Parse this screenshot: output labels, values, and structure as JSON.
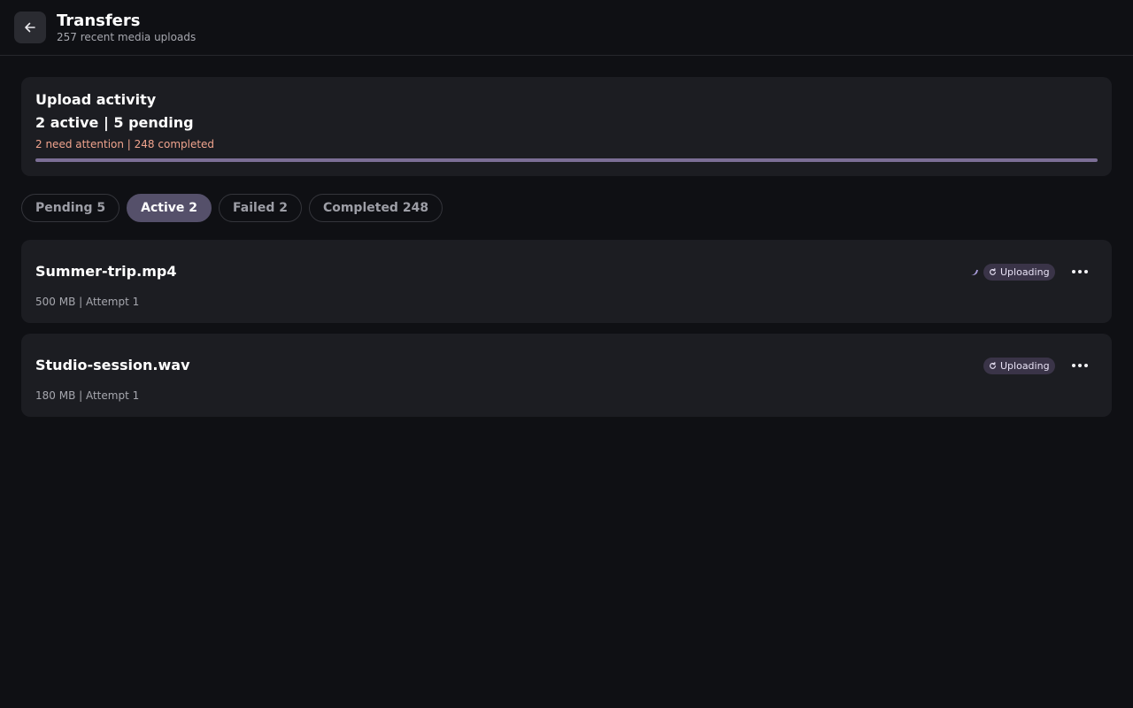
{
  "header": {
    "back_icon": "arrow-left-icon",
    "title": "Transfers",
    "subtitle": "257 recent media uploads"
  },
  "summary": {
    "title": "Upload activity",
    "main": "2 active | 5 pending",
    "attention": "2 need attention | 248 completed",
    "attention_color": "#f1a48e",
    "progress_fraction": 1.0
  },
  "tabs": [
    {
      "label": "Pending 5",
      "active": false
    },
    {
      "label": "Active 2",
      "active": true
    },
    {
      "label": "Failed 2",
      "active": false
    },
    {
      "label": "Completed 248",
      "active": false
    }
  ],
  "transfers": [
    {
      "name": "Summer-trip.mp4",
      "meta": "500 MB | Attempt 1",
      "status": "Uploading",
      "status_icon": "refresh-icon",
      "more_icon": "more-horizontal-icon"
    },
    {
      "name": "Studio-session.wav",
      "meta": "180 MB | Attempt 1",
      "status": "Uploading",
      "status_icon": "refresh-icon",
      "more_icon": "more-horizontal-icon"
    }
  ],
  "colors": {
    "background": "#0f1014",
    "card": "#1c1d22",
    "accent": "#55506a",
    "badge": "#3a3448"
  }
}
